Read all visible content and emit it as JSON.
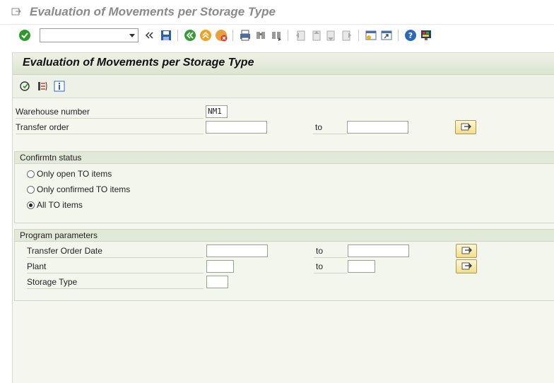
{
  "window": {
    "title": "Evaluation of Movements per Storage Type"
  },
  "toolbar": {
    "command_field_value": "",
    "icons": [
      "check-icon",
      "back-double-icon",
      "save-icon",
      "back-icon",
      "exit-icon",
      "cancel-icon",
      "print-icon",
      "find-icon",
      "find-next-icon",
      "first-page-icon",
      "previous-page-icon",
      "next-page-icon",
      "last-page-icon",
      "create-session-icon",
      "shortcut-icon",
      "help-icon",
      "customize-layout-icon"
    ]
  },
  "screen": {
    "title": "Evaluation of Movements per Storage Type",
    "app_icons": [
      "execute-icon",
      "get-variant-icon",
      "info-icon"
    ]
  },
  "fields": {
    "warehouse_number": {
      "label": "Warehouse number",
      "value": "NM1"
    },
    "transfer_order": {
      "label": "Transfer order",
      "from": "",
      "to_label": "to",
      "to": ""
    }
  },
  "confirmation_status": {
    "title": "Confirmtn status",
    "options": [
      {
        "label": "Only open TO items",
        "selected": false
      },
      {
        "label": "Only confirmed TO items",
        "selected": false
      },
      {
        "label": "All TO items",
        "selected": true
      }
    ]
  },
  "program_parameters": {
    "title": "Program parameters",
    "transfer_order_date": {
      "label": "Transfer Order Date",
      "from": "",
      "to_label": "to",
      "to": ""
    },
    "plant": {
      "label": "Plant",
      "from": "",
      "to_label": "to",
      "to": ""
    },
    "storage_type": {
      "label": "Storage Type",
      "value": ""
    }
  }
}
